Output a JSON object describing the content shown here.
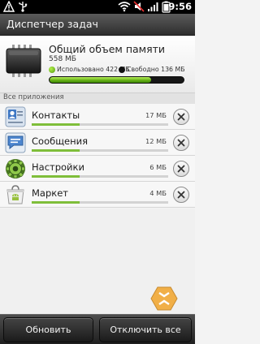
{
  "status_bar": {
    "time": "9:56",
    "icons": [
      "warning-icon",
      "usb-icon",
      "wifi-icon",
      "mute-icon",
      "signal-icon",
      "battery-icon"
    ]
  },
  "title_bar": {
    "title": "Диспетчер задач"
  },
  "memory": {
    "title": "Общий объем памяти",
    "total": "558 МБ",
    "used_label": "Использовано 422 МБ",
    "free_label": "Свободно 136 МБ",
    "used_fraction": 0.756,
    "used_color": "#6db51c",
    "free_color": "#111111"
  },
  "section": {
    "header": "Все приложения"
  },
  "apps": [
    {
      "name": "Контакты",
      "size": "17 МБ",
      "icon": "contacts-icon",
      "usage": 0.35
    },
    {
      "name": "Сообщения",
      "size": "12 МБ",
      "icon": "messages-icon",
      "usage": 0.35
    },
    {
      "name": "Настройки",
      "size": "6 МБ",
      "icon": "settings-gear-icon",
      "usage": 0.35
    },
    {
      "name": "Маркет",
      "size": "4 МБ",
      "icon": "market-icon",
      "usage": 0.35
    }
  ],
  "bottom_bar": {
    "refresh_label": "Обновить",
    "kill_all_label": "Отключить все"
  },
  "watermark": {
    "icon": "hexagon-watermark-icon"
  }
}
